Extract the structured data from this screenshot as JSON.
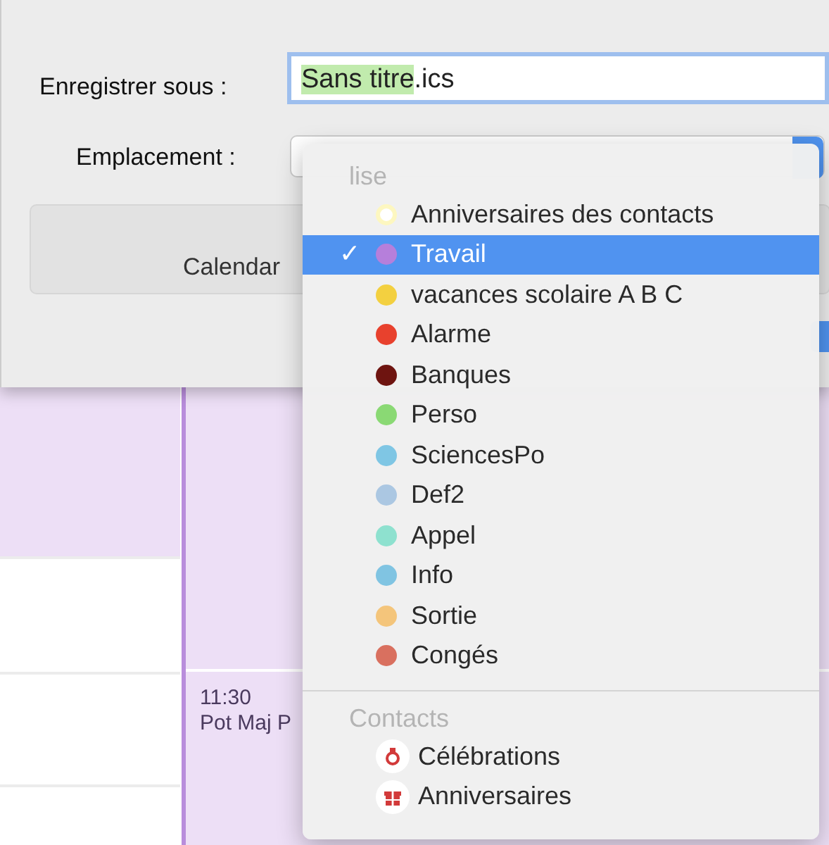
{
  "dialog": {
    "save_as": {
      "label": "Enregistrer sous :",
      "selected_text": "Sans titre",
      "text": ".ics"
    },
    "location": {
      "label": "Emplacement :"
    },
    "button": "Calendar"
  },
  "calendar": {
    "events": [
      {
        "time": "11:30",
        "title": "Pot Maj P"
      }
    ]
  },
  "menu": {
    "check": "✓",
    "sections": [
      {
        "title": "lise",
        "items": [
          {
            "label": "Anniversaires des contacts",
            "kind": "outline",
            "color": "#fdf7c0",
            "selected": false
          },
          {
            "label": "Travail",
            "kind": "dot",
            "color": "#b67fdb",
            "selected": true
          },
          {
            "label": "vacances scolaire  A B C",
            "kind": "dot",
            "color": "#f3d040",
            "selected": false
          },
          {
            "label": "Alarme",
            "kind": "dot",
            "color": "#e8412d",
            "selected": false
          },
          {
            "label": "Banques",
            "kind": "dot",
            "color": "#6e1410",
            "selected": false
          },
          {
            "label": "Perso",
            "kind": "dot",
            "color": "#8ad974",
            "selected": false
          },
          {
            "label": "SciencesPo",
            "kind": "dot",
            "color": "#7fc6e4",
            "selected": false
          },
          {
            "label": "Def2",
            "kind": "dot",
            "color": "#abc7e2",
            "selected": false
          },
          {
            "label": "Appel",
            "kind": "dot",
            "color": "#8ee1cf",
            "selected": false
          },
          {
            "label": "Info",
            "kind": "dot",
            "color": "#80c4e2",
            "selected": false
          },
          {
            "label": "Sortie",
            "kind": "dot",
            "color": "#f4c57b",
            "selected": false
          },
          {
            "label": "Congés",
            "kind": "dot",
            "color": "#d9705f",
            "selected": false
          }
        ]
      },
      {
        "title": "Contacts",
        "items": [
          {
            "label": "Célébrations",
            "kind": "ring",
            "selected": false
          },
          {
            "label": "Anniversaires",
            "kind": "gift",
            "selected": false
          }
        ]
      }
    ]
  }
}
